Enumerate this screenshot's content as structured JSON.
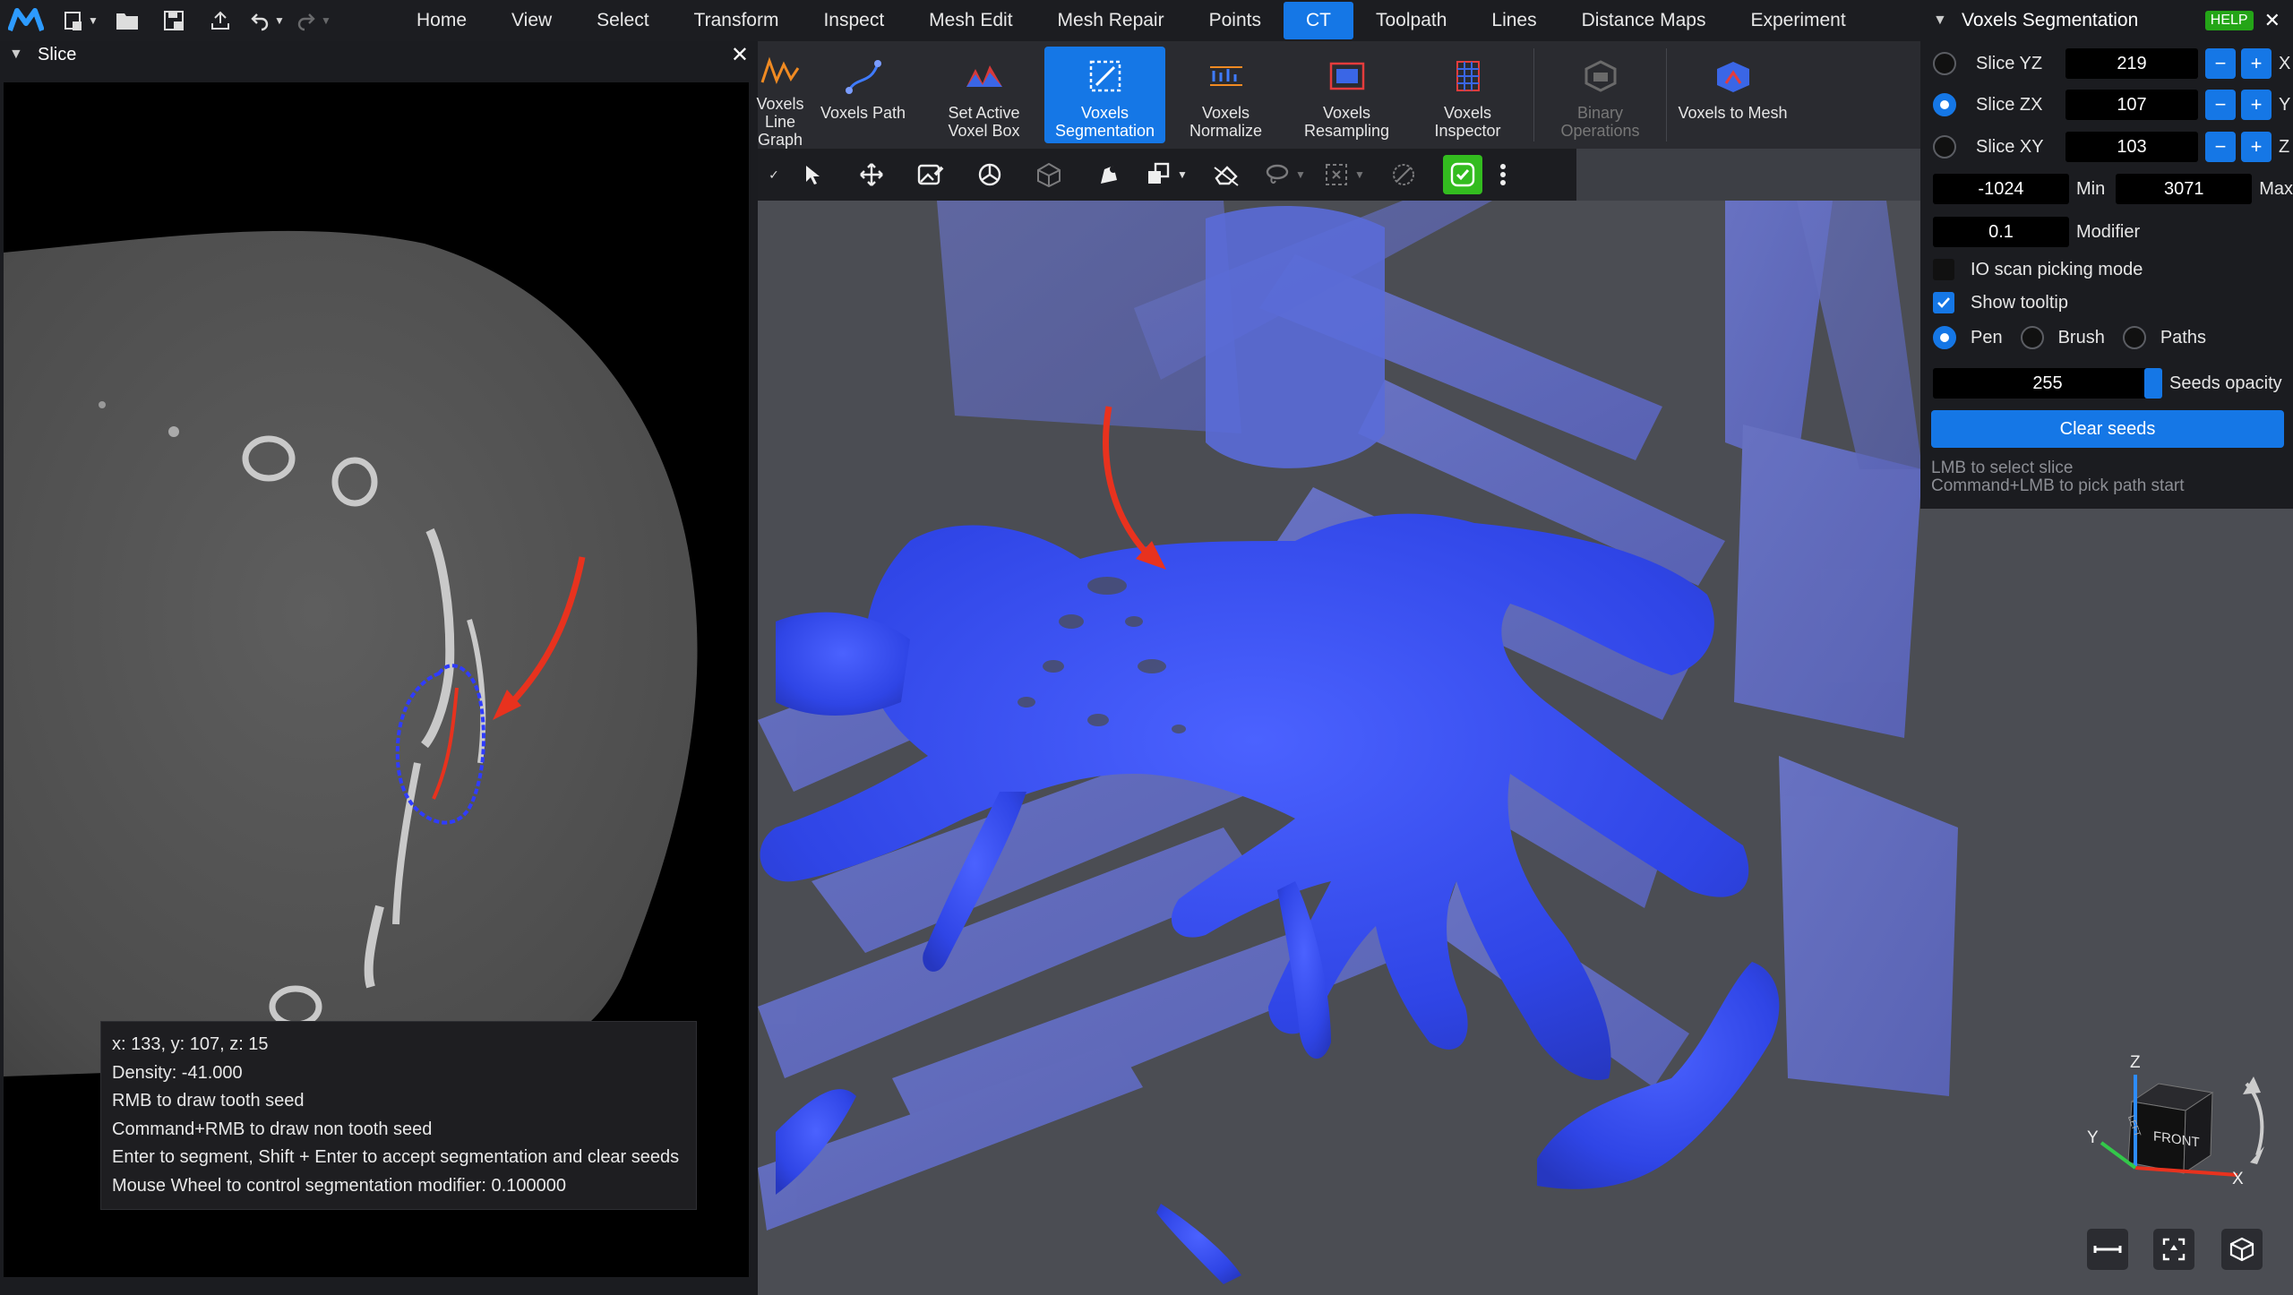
{
  "menubar": {
    "tabs": [
      "Home",
      "View",
      "Select",
      "Transform",
      "Inspect",
      "Mesh Edit",
      "Mesh Repair",
      "Points",
      "CT",
      "Toolpath",
      "Lines",
      "Distance Maps",
      "Experiment"
    ],
    "active_tab": "CT"
  },
  "slice_panel": {
    "title": "Slice"
  },
  "tooltip": {
    "lines": [
      "x: 133, y: 107, z: 15",
      "Density: -41.000",
      "RMB to draw tooth seed",
      "Command+RMB to draw non tooth seed",
      "Enter to segment, Shift + Enter to accept segmentation and clear seeds",
      "Mouse Wheel to control segmentation modifier: 0.100000"
    ]
  },
  "ribbon": {
    "buttons": [
      {
        "label1": "Voxels",
        "label2": "Line Graph"
      },
      {
        "label1": "Voxels Path",
        "label2": ""
      },
      {
        "label1": "Set Active",
        "label2": "Voxel Box"
      },
      {
        "label1": "Voxels",
        "label2": "Segmentation"
      },
      {
        "label1": "Voxels",
        "label2": "Normalize"
      },
      {
        "label1": "Voxels",
        "label2": "Resampling"
      },
      {
        "label1": "Voxels",
        "label2": "Inspector"
      },
      {
        "label1": "Binary",
        "label2": "Operations"
      },
      {
        "label1": "Voxels to Mesh",
        "label2": ""
      }
    ]
  },
  "seg_panel": {
    "title": "Voxels Segmentation",
    "help_label": "HELP",
    "slices": [
      {
        "label": "Slice YZ",
        "value": "219",
        "axis": "X",
        "selected": false
      },
      {
        "label": "Slice ZX",
        "value": "107",
        "axis": "Y",
        "selected": true
      },
      {
        "label": "Slice XY",
        "value": "103",
        "axis": "Z",
        "selected": false
      }
    ],
    "min_value": "-1024",
    "min_label": "Min",
    "max_value": "3071",
    "max_label": "Max",
    "modifier_value": "0.1",
    "modifier_label": "Modifier",
    "io_scan_label": "IO scan picking mode",
    "io_scan_checked": false,
    "show_tooltip_label": "Show tooltip",
    "show_tooltip_checked": true,
    "modes": [
      "Pen",
      "Brush",
      "Paths"
    ],
    "selected_mode": "Pen",
    "seeds_opacity_value": "255",
    "seeds_opacity_label": "Seeds opacity",
    "clear_seeds_label": "Clear seeds",
    "hint1": "LMB to select slice",
    "hint2": "Command+LMB to pick path start"
  },
  "view_cube": {
    "face_label": "FRONT",
    "side_label": "LEFT",
    "axis_x": "X",
    "axis_y": "Y",
    "axis_z": "Z"
  },
  "colors": {
    "accent": "#1577e6",
    "green": "#33bc1f",
    "seed_red": "#e8321e",
    "segmentation": "#3b4cf0"
  }
}
